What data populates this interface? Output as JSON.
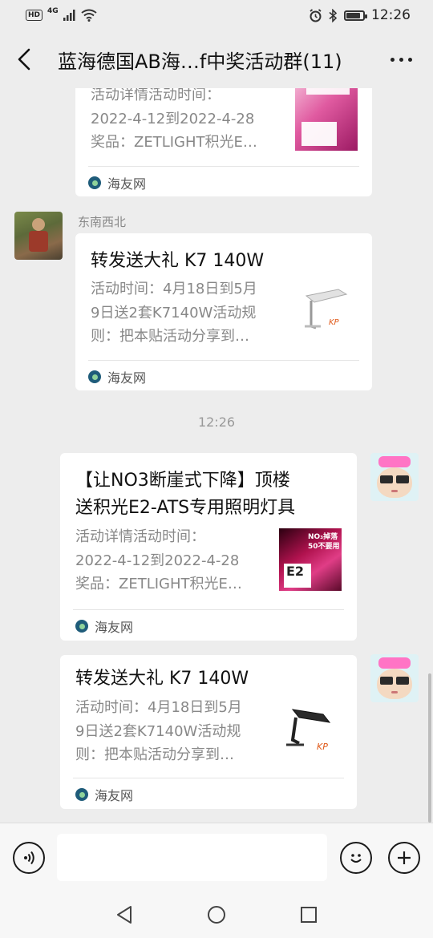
{
  "status_bar": {
    "network": "4G",
    "time": "12:26",
    "battery_level": 0.85
  },
  "nav": {
    "title": "蓝海德国AB海…f中奖活动群(11)"
  },
  "messages": [
    {
      "title": "",
      "desc": [
        "活动详情活动时间：",
        "2022-4-12到2022-4-28",
        "奖品：ZETLIGHT积光E…"
      ],
      "source": "海友网",
      "thumb": "pink-led-promo-image"
    },
    {
      "sender": "东南西北",
      "title": "转发送大礼 K7 140W",
      "desc": [
        "活动时间：4月18日到5月",
        "9日送2套K7140W活动规",
        "则：把本贴活动分享到…"
      ],
      "source": "海友网",
      "thumb": "white-lamp-fixture-image"
    },
    {
      "title_lines": [
        "【让NO3断崖式下降】顶楼",
        "送积光E2-ATS专用照明灯具"
      ],
      "desc": [
        "活动详情活动时间：",
        "2022-4-12到2022-4-28",
        "奖品：ZETLIGHT积光E…"
      ],
      "source": "海友网",
      "thumb": "pink-led-promo-image",
      "thumb_text": [
        "NO₃掉落",
        "50不要用",
        "E2"
      ]
    },
    {
      "title": "转发送大礼 K7 140W",
      "desc": [
        "活动时间：4月18日到5月",
        "9日送2套K7140W活动规",
        "则：把本贴活动分享到…"
      ],
      "source": "海友网",
      "thumb": "black-lamp-fixture-image"
    }
  ],
  "timestamp": "12:26",
  "input": {
    "placeholder": ""
  },
  "colors": {
    "background": "#ededed",
    "bubble": "#ffffff",
    "source_icon": "#1f5c7a",
    "promo_pink": "#c2185b"
  }
}
